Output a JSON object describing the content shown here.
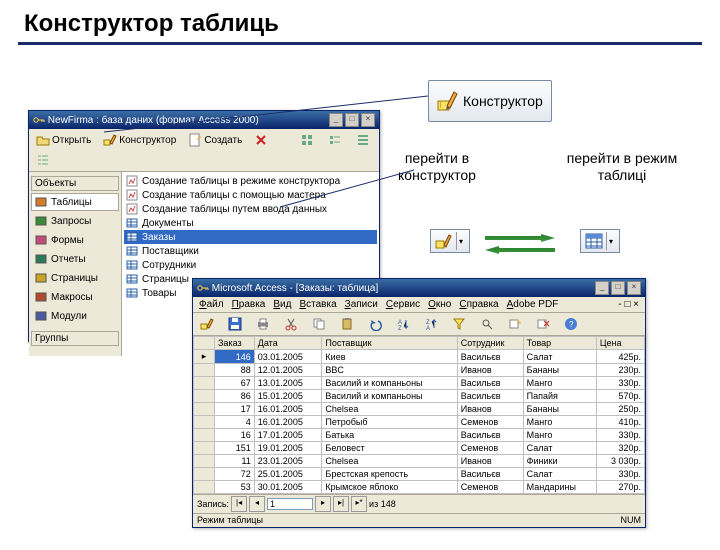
{
  "slide": {
    "title": "Конструктор таблиць"
  },
  "bigButton": {
    "label": "Конструктор"
  },
  "annot": {
    "left": "перейти в конструктор",
    "right": "перейти в режим таблиці"
  },
  "dbWindow": {
    "title": "NewFirma : база даних (формат Access 2000)",
    "toolbar": {
      "open": "Открыть",
      "design": "Конструктор",
      "create": "Создать"
    },
    "navHeader": "Объекты",
    "navFooter": "Группы",
    "nav": [
      {
        "label": "Таблицы",
        "sel": true
      },
      {
        "label": "Запросы"
      },
      {
        "label": "Формы"
      },
      {
        "label": "Отчеты"
      },
      {
        "label": "Страницы"
      },
      {
        "label": "Макросы"
      },
      {
        "label": "Модули"
      }
    ],
    "list": [
      {
        "label": "Создание таблицы в режиме конструктора",
        "w": true
      },
      {
        "label": "Создание таблицы с помощью мастера",
        "w": true
      },
      {
        "label": "Создание таблицы путем ввода данных",
        "w": true
      },
      {
        "label": "Документы"
      },
      {
        "label": "Заказы",
        "sel": true
      },
      {
        "label": "Поставщики"
      },
      {
        "label": "Сотрудники"
      },
      {
        "label": "Страницы"
      },
      {
        "label": "Товары"
      }
    ]
  },
  "accessWindow": {
    "title": "Microsoft Access - [Заказы: таблица]",
    "menus": [
      "Файл",
      "Правка",
      "Вид",
      "Вставка",
      "Записи",
      "Сервис",
      "Окно",
      "Справка",
      "Adobe PDF"
    ],
    "columns": [
      "Заказ",
      "Дата",
      "Поставщик",
      "Сотрудник",
      "Товар",
      "Цена"
    ],
    "rows": [
      [
        "146",
        "03.01.2005",
        "Киев",
        "Васильєв",
        "Салат",
        "425р."
      ],
      [
        "88",
        "12.01.2005",
        "BBC",
        "Иванов",
        "Бананы",
        "230р."
      ],
      [
        "67",
        "13.01.2005",
        "Василий и компаньоны",
        "Васильєв",
        "Манго",
        "330р."
      ],
      [
        "86",
        "15.01.2005",
        "Василий и компаньоны",
        "Васильєв",
        "Папайя",
        "570р."
      ],
      [
        "17",
        "16.01.2005",
        "Chelsea",
        "Иванов",
        "Бананы",
        "250р."
      ],
      [
        "4",
        "16.01.2005",
        "Петробыб",
        "Семенов",
        "Манго",
        "410р."
      ],
      [
        "16",
        "17.01.2005",
        "Батька",
        "Васильєв",
        "Манго",
        "330р."
      ],
      [
        "151",
        "19.01.2005",
        "Беловест",
        "Семенов",
        "Салат",
        "320р."
      ],
      [
        "11",
        "23.01.2005",
        "Chelsea",
        "Иванов",
        "Финики",
        "3 030р."
      ],
      [
        "72",
        "25.01.2005",
        "Брестская крепость",
        "Васильєв",
        "Салат",
        "330р."
      ],
      [
        "53",
        "30.01.2005",
        "Крымское яблоко",
        "Семенов",
        "Мандарины",
        "270р."
      ]
    ],
    "recordNav": {
      "label": "Запись:",
      "value": "1",
      "total": "из 148"
    },
    "status": {
      "left": "Режим таблицы",
      "right": "NUM"
    }
  }
}
